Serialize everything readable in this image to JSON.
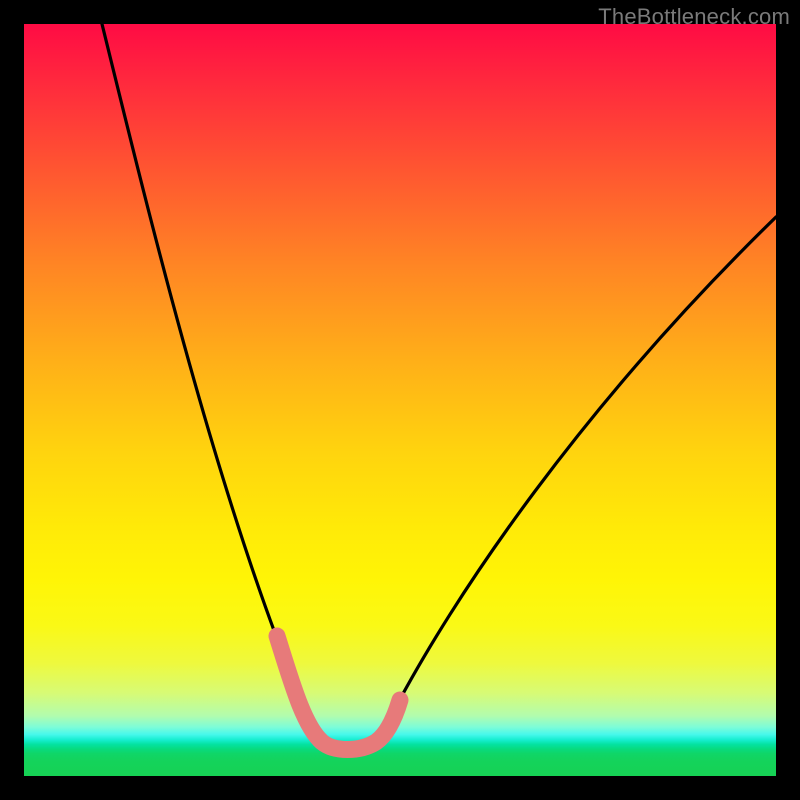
{
  "watermark": {
    "text": "TheBottleneck.com"
  },
  "colors": {
    "frame_border": "#000000",
    "curve_black": "#000000",
    "curve_pink": "#e77a7a"
  },
  "chart_data": {
    "type": "line",
    "title": "",
    "xlabel": "",
    "ylabel": "",
    "xlim": [
      0,
      100
    ],
    "ylim": [
      0,
      100
    ],
    "grid": false,
    "series": [
      {
        "name": "bottleneck-curve",
        "x": [
          10,
          15,
          20,
          25,
          30,
          34,
          36,
          38,
          40,
          42,
          44,
          46,
          50,
          55,
          60,
          65,
          70,
          75,
          80,
          85,
          90,
          95,
          100
        ],
        "y": [
          100,
          84,
          68,
          53,
          37,
          23,
          16,
          10,
          6,
          4,
          3,
          3,
          4,
          8,
          14,
          21,
          29,
          37,
          45,
          53,
          61,
          68,
          75
        ]
      },
      {
        "name": "highlight-segment",
        "x": [
          34,
          36,
          38,
          40,
          42,
          44,
          46,
          48,
          50
        ],
        "y": [
          23,
          16,
          10,
          6,
          4,
          3,
          3,
          3.5,
          4
        ]
      }
    ]
  }
}
